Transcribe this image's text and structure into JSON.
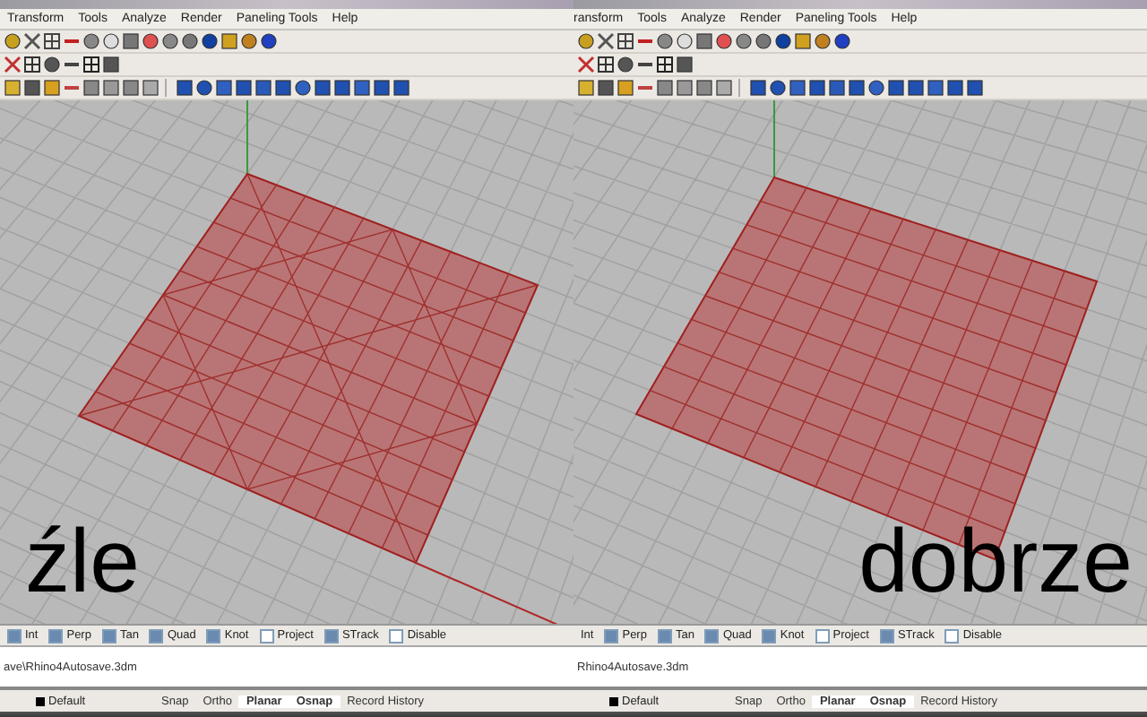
{
  "panels": [
    {
      "caption": "źle",
      "mesh_diagonals": true,
      "menu": [
        "Transform",
        "Tools",
        "Analyze",
        "Render",
        "Paneling Tools",
        "Help"
      ],
      "osnaps": [
        {
          "label": "Int",
          "checked": true
        },
        {
          "label": "Perp",
          "checked": true
        },
        {
          "label": "Tan",
          "checked": true
        },
        {
          "label": "Quad",
          "checked": true
        },
        {
          "label": "Knot",
          "checked": true
        },
        {
          "label": "Project",
          "checked": false
        },
        {
          "label": "STrack",
          "checked": true
        },
        {
          "label": "Disable",
          "checked": false
        }
      ],
      "command_history": "ave\\Rhino4Autosave.3dm",
      "layer": "Default",
      "status_toggles": [
        {
          "label": "Snap",
          "on": false
        },
        {
          "label": "Ortho",
          "on": false
        },
        {
          "label": "Planar",
          "on": true
        },
        {
          "label": "Osnap",
          "on": true
        },
        {
          "label": "Record History",
          "on": false
        }
      ]
    },
    {
      "caption": "dobrze",
      "mesh_diagonals": false,
      "menu": [
        "ransform",
        "Tools",
        "Analyze",
        "Render",
        "Paneling Tools",
        "Help"
      ],
      "osnaps": [
        {
          "label": "Int"
        },
        {
          "label": "Perp",
          "checked": true
        },
        {
          "label": "Tan",
          "checked": true
        },
        {
          "label": "Quad",
          "checked": true
        },
        {
          "label": "Knot",
          "checked": true
        },
        {
          "label": "Project",
          "checked": false
        },
        {
          "label": "STrack",
          "checked": true
        },
        {
          "label": "Disable",
          "checked": false
        }
      ],
      "command_history": "Rhino4Autosave.3dm",
      "layer": "Default",
      "status_toggles": [
        {
          "label": "Snap",
          "on": false
        },
        {
          "label": "Ortho",
          "on": false
        },
        {
          "label": "Planar",
          "on": true
        },
        {
          "label": "Osnap",
          "on": true
        },
        {
          "label": "Record History",
          "on": false
        }
      ]
    }
  ]
}
